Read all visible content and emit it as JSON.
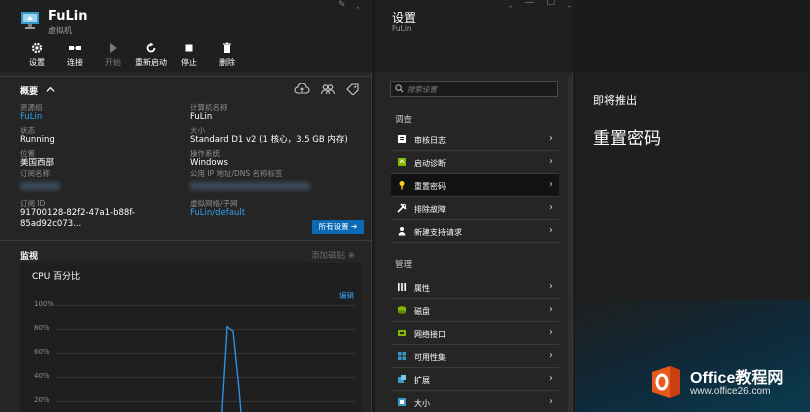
{
  "vm": {
    "title": "FuLin",
    "subtitle": "虚拟机",
    "toolbar": [
      {
        "label": "设置",
        "icon": "gear-icon"
      },
      {
        "label": "连接",
        "icon": "connect-icon"
      },
      {
        "label": "开始",
        "icon": "play-icon"
      },
      {
        "label": "重新启动",
        "icon": "restart-icon"
      },
      {
        "label": "停止",
        "icon": "stop-icon"
      },
      {
        "label": "删除",
        "icon": "trash-icon"
      }
    ],
    "overview": {
      "title": "概要",
      "left": [
        {
          "label": "资源组",
          "value": "FuLin"
        },
        {
          "label": "状态",
          "value": "Running"
        },
        {
          "label": "位置",
          "value": "美国西部"
        },
        {
          "label": "订阅名称",
          "value": ""
        },
        {
          "label": "订阅 ID",
          "value": "91700128-82f2-47a1-b88f-85ad92c073..."
        }
      ],
      "right": [
        {
          "label": "计算机名称",
          "value": "FuLin"
        },
        {
          "label": "大小",
          "value": "Standard D1 v2 (1 核心，3.5 GB 内存)"
        },
        {
          "label": "操作系统",
          "value": "Windows"
        },
        {
          "label": "公用 IP 地址/DNS 名称标签",
          "value": ""
        },
        {
          "label": "虚拟网络/子网",
          "value": "FuLin/default"
        }
      ],
      "all_settings": "所有设置 ➔"
    },
    "monitor": {
      "title": "监视",
      "add_tile": "添加磁贴 ⊕",
      "chart_title": "CPU 百分比",
      "edit": "编辑"
    }
  },
  "chart_data": {
    "type": "line",
    "title": "CPU 百分比",
    "y_ticks": [
      "100%",
      "80%",
      "60%",
      "40%",
      "20%"
    ],
    "ylim": [
      0,
      100
    ],
    "series": [
      {
        "x": [
          0.0,
          0.55,
          0.57,
          0.59,
          0.61,
          0.62
        ],
        "values": [
          0,
          0,
          82,
          78,
          30,
          0
        ]
      }
    ]
  },
  "settings": {
    "title": "设置",
    "subtitle": "FuLin",
    "search_placeholder": "搜索设置",
    "groups": [
      {
        "header": "调查",
        "items": [
          {
            "label": "审核日志",
            "icon": "audit-log-icon",
            "color": "#ffffff"
          },
          {
            "label": "启动诊断",
            "icon": "boot-diagnostics-icon",
            "color": "#7fba00"
          },
          {
            "label": "重置密码",
            "icon": "key-icon",
            "color": "#fcd116",
            "active": true
          },
          {
            "label": "排除故障",
            "icon": "troubleshoot-icon",
            "color": "#ffffff"
          },
          {
            "label": "新建支持请求",
            "icon": "support-request-icon",
            "color": "#ffffff"
          }
        ]
      },
      {
        "header": "管理",
        "items": [
          {
            "label": "属性",
            "icon": "properties-icon",
            "color": "#ffffff"
          },
          {
            "label": "磁盘",
            "icon": "disk-icon",
            "color": "#7fba00"
          },
          {
            "label": "网络接口",
            "icon": "network-interface-icon",
            "color": "#7fba00"
          },
          {
            "label": "可用性集",
            "icon": "availability-set-icon",
            "color": "#3999c6"
          },
          {
            "label": "扩展",
            "icon": "extensions-icon",
            "color": "#3999c6"
          },
          {
            "label": "大小",
            "icon": "size-icon",
            "color": "#3999c6"
          }
        ]
      }
    ]
  },
  "coming": {
    "kicker": "即将推出",
    "title": "重置密码"
  },
  "watermark": {
    "brand": "Office教程网",
    "url": "www.office26.com",
    "accent": "#e8591a"
  },
  "colors": {
    "link": "#35a2f0",
    "accent_button": "#0b6ab5"
  }
}
